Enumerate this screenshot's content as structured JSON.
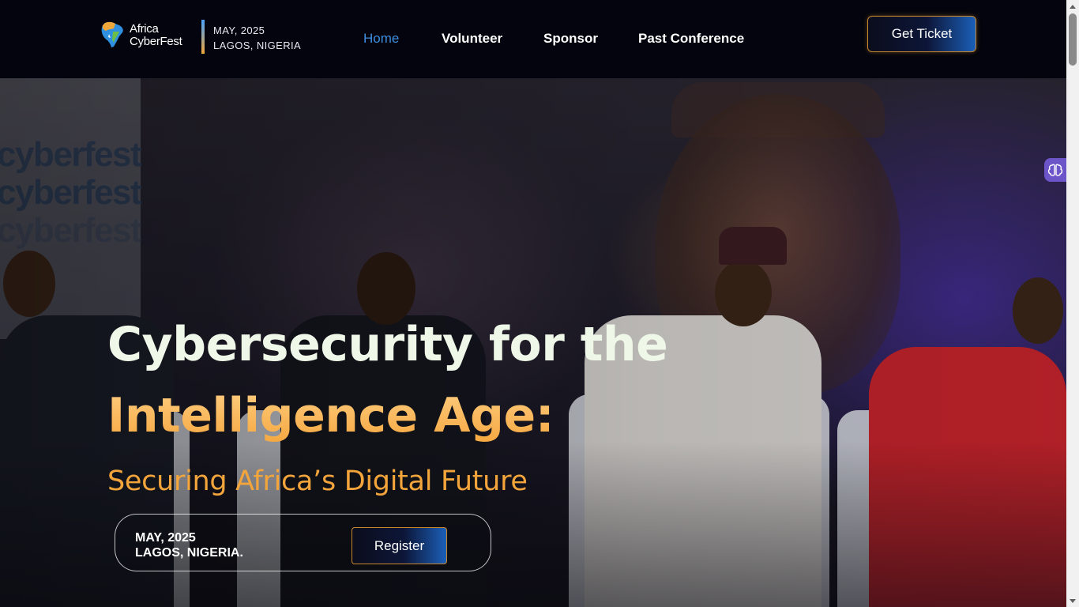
{
  "brand": {
    "logo_line1": "Africa",
    "logo_line2": "CyberFest",
    "event_date": "MAY, 2025",
    "event_location": "LAGOS, NIGERIA",
    "accent_blue": "#3d8ee0",
    "accent_orange": "#f4a236"
  },
  "nav": {
    "items": [
      {
        "label": "Home",
        "active": true
      },
      {
        "label": "Volunteer",
        "active": false
      },
      {
        "label": "Sponsor",
        "active": false
      },
      {
        "label": "Past Conference",
        "active": false
      }
    ],
    "ticket_button": "Get Ticket"
  },
  "hero": {
    "backdrop_text": [
      "cyberfest",
      "cyberfest",
      "cyberfest"
    ],
    "headline_line1": "Cybersecurity for the",
    "headline_line2": "Intelligence Age:",
    "subheadline": "Securing Africa’s Digital Future",
    "register_date": "MAY, 2025",
    "register_location": "LAGOS, NIGERIA.",
    "register_button": "Register"
  },
  "widgets": {
    "side_widget_icon": "brain-icon"
  }
}
